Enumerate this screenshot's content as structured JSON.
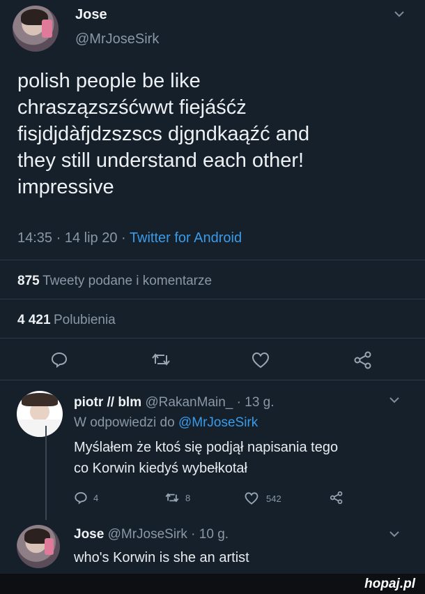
{
  "main_tweet": {
    "author_name": "Jose",
    "author_handle": "@MrJoseSirk",
    "text": "polish people be like\nchraszązszśćwwt fiejáśćż\nfisjdjdàfjdzszscs djgndkaąźć and\nthey still understand each other!\nimpressive",
    "time": "14:35",
    "date": "14 lip 20",
    "separator": "·",
    "client": "Twitter for Android",
    "retweets_count": "875",
    "retweets_label": "Tweety podane i komentarze",
    "likes_count": "4 421",
    "likes_label": "Polubienia"
  },
  "reply_1": {
    "author_name": "piotr // blm",
    "author_handle": "@RakanMain_",
    "age": "· 13 g.",
    "reply_to_label": "W odpowiedzi do",
    "reply_to_handle": "@MrJoseSirk",
    "text": "Myślałem że ktoś się podjął napisania tego\nco Korwin kiedyś wybełkotał",
    "reply_count": "4",
    "retweet_count": "8",
    "like_count": "542"
  },
  "reply_2": {
    "author_name": "Jose",
    "author_handle": "@MrJoseSirk",
    "age": "· 10 g.",
    "text": "who's Korwin is she an artist"
  },
  "watermark": "hopaj.pl",
  "colors": {
    "background": "#15202b",
    "accent": "#3b9be8",
    "muted": "#8a98a6"
  },
  "icons": [
    "chevron-down-icon",
    "reply-icon",
    "retweet-icon",
    "like-icon",
    "share-icon"
  ]
}
